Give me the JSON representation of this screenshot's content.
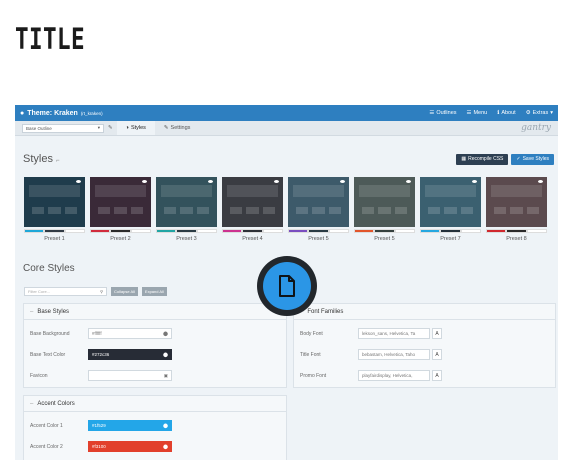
{
  "page": {
    "title": "TITLE"
  },
  "app": {
    "title": "Theme: Kraken",
    "subtitle": "(rt_kraken)",
    "menu": [
      "Outlines",
      "Menu",
      "About",
      "Extras"
    ],
    "outline_value": "Base Outline",
    "tabs": [
      "Styles",
      "Settings"
    ],
    "brand": "gantry"
  },
  "styles": {
    "heading": "Styles",
    "recompile": "Recompile CSS",
    "save": "Save Styles",
    "presets": [
      {
        "label": "Preset 1",
        "bg": "#1f3c4c",
        "colors": [
          "#1ea7d8",
          "#303a44",
          "#ffffff"
        ]
      },
      {
        "label": "Preset 2",
        "bg": "#3a2a38",
        "colors": [
          "#d12c3d",
          "#2a2a2a",
          "#ffffff"
        ]
      },
      {
        "label": "Preset 3",
        "bg": "#33525c",
        "colors": [
          "#21a5a4",
          "#2a3b44",
          "#ffffff"
        ]
      },
      {
        "label": "Preset 4",
        "bg": "#3a3c42",
        "colors": [
          "#cc3290",
          "#2e3138",
          "#ffffff"
        ]
      },
      {
        "label": "Preset 5",
        "bg": "#3d5a6a",
        "colors": [
          "#7a4ec0",
          "#2a3b44",
          "#ffffff"
        ]
      },
      {
        "label": "Preset 5",
        "bg": "#4d5a58",
        "colors": [
          "#e2552b",
          "#34403e",
          "#ffffff"
        ]
      },
      {
        "label": "Preset 7",
        "bg": "#3b6070",
        "colors": [
          "#25a7e0",
          "#23303a",
          "#ffffff"
        ]
      },
      {
        "label": "Preset 8",
        "bg": "#5b4a4e",
        "colors": [
          "#d0282e",
          "#2a2a2a",
          "#ffffff"
        ]
      }
    ]
  },
  "core": {
    "heading": "Core Styles",
    "filter_placeholder": "Filter Core...",
    "collapse": "Collapse All",
    "expand": "Expand All"
  },
  "base_styles": {
    "title": "Base Styles",
    "rows": [
      {
        "label": "Base Background",
        "value": "#ffffff",
        "bg": "#ffffff",
        "fg": "#777777"
      },
      {
        "label": "Base Text Color",
        "value": "#272c36",
        "bg": "#272c36",
        "fg": "#ffffff"
      },
      {
        "label": "Favicon",
        "value": "",
        "bg": "#ffffff",
        "fg": "#777777"
      }
    ]
  },
  "font_families": {
    "title": "Font Families",
    "rows": [
      {
        "label": "Body Font",
        "value": "lekson_sans, Helvetica, Ta"
      },
      {
        "label": "Title Font",
        "value": "bebastam, Helvetica, Taho"
      },
      {
        "label": "Promo Font",
        "value": "playfairdisplay, Helvetica,"
      }
    ]
  },
  "accent_colors": {
    "title": "Accent Colors",
    "rows": [
      {
        "label": "Accent Color 1",
        "value": "#1f529",
        "bg": "#23a6e8",
        "fg": "#ffffff"
      },
      {
        "label": "Accent Color 2",
        "value": "#f3100",
        "bg": "#e2402c",
        "fg": "#ffffff"
      }
    ]
  }
}
